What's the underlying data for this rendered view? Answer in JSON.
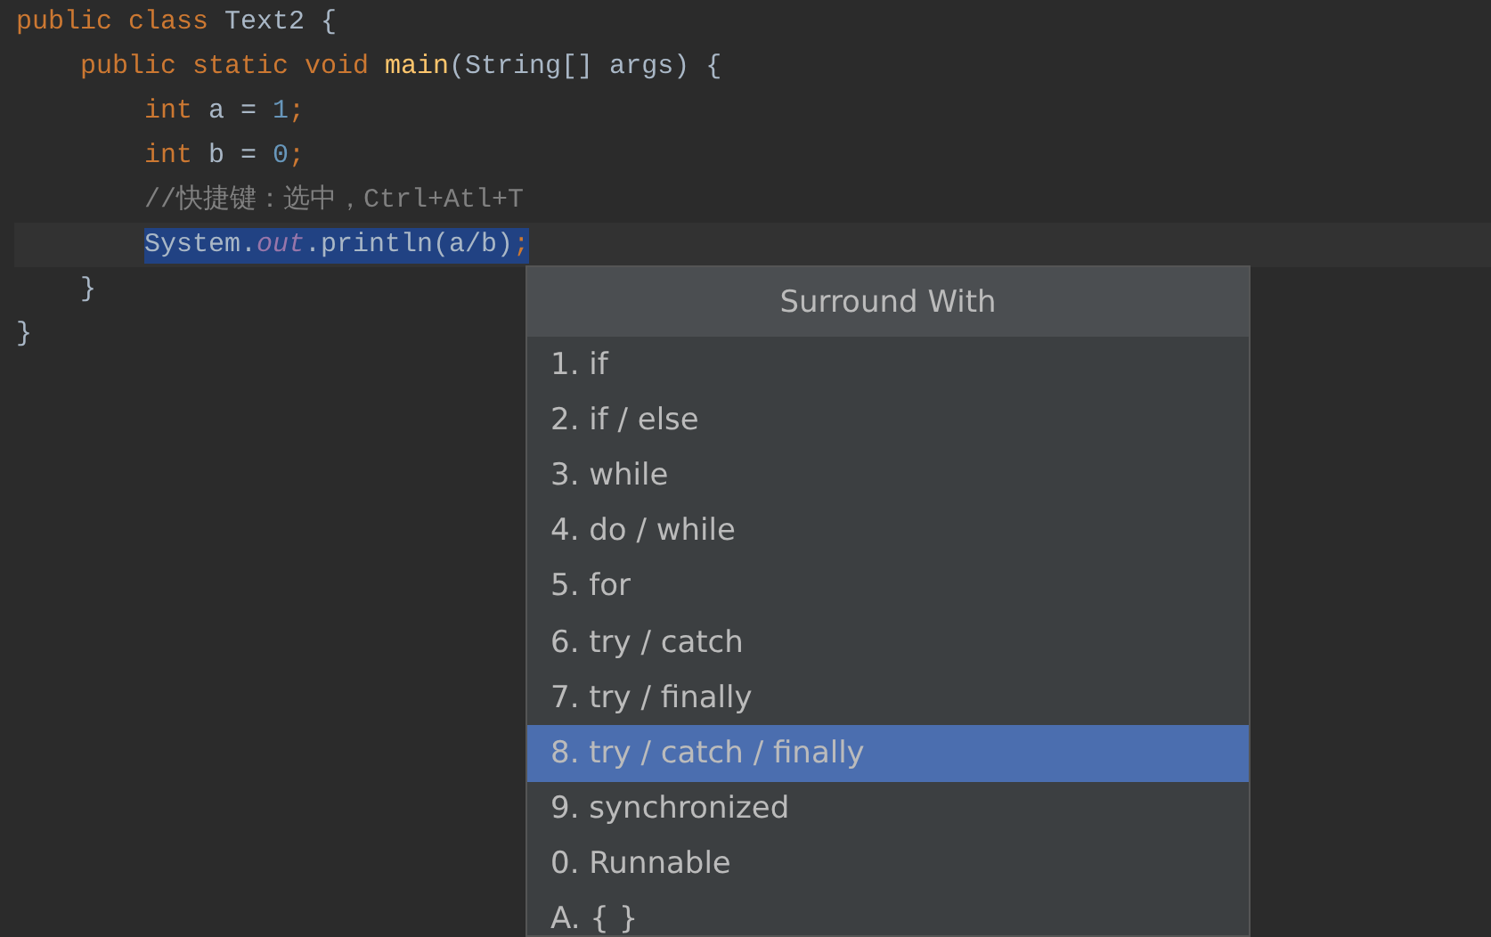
{
  "editor": {
    "lines": [
      {
        "selected": false,
        "tokens": [
          {
            "kind": "keyword",
            "text": "public class "
          },
          {
            "kind": "plain",
            "text": "Text2 {"
          }
        ],
        "children": [
          {
            "selected": false,
            "tokens": [
              {
                "kind": "keyword",
                "text": "public static void "
              },
              {
                "kind": "method",
                "text": "main"
              },
              {
                "kind": "plain",
                "text": "(String[] args) {"
              }
            ],
            "children": [
              {
                "selected": false,
                "tokens": [
                  {
                    "kind": "keyword",
                    "text": "int "
                  },
                  {
                    "kind": "plain",
                    "text": "a = "
                  },
                  {
                    "kind": "number",
                    "text": "1"
                  },
                  {
                    "kind": "keyword",
                    "text": ";"
                  }
                ]
              },
              {
                "selected": false,
                "tokens": [
                  {
                    "kind": "keyword",
                    "text": "int "
                  },
                  {
                    "kind": "plain",
                    "text": "b = "
                  },
                  {
                    "kind": "number",
                    "text": "0"
                  },
                  {
                    "kind": "keyword",
                    "text": ";"
                  }
                ]
              },
              {
                "selected": false,
                "tokens": [
                  {
                    "kind": "comment",
                    "text": "//快捷键：选中，Ctrl+Atl+T"
                  }
                ]
              },
              {
                "selected": true,
                "tokens": [
                  {
                    "kind": "plain",
                    "text": "System."
                  },
                  {
                    "kind": "field",
                    "text": "out"
                  },
                  {
                    "kind": "plain",
                    "text": ".println(a/b)"
                  },
                  {
                    "kind": "keyword",
                    "text": ";"
                  }
                ]
              }
            ]
          },
          {
            "selected": false,
            "tokens": [
              {
                "kind": "plain",
                "text": "}"
              }
            ]
          }
        ]
      },
      {
        "selected": false,
        "tokens": [
          {
            "kind": "plain",
            "text": "}"
          }
        ]
      }
    ]
  },
  "popup": {
    "title": "Surround With",
    "items": [
      {
        "label": "1. if",
        "selected": false
      },
      {
        "label": "2. if / else",
        "selected": false
      },
      {
        "label": "3. while",
        "selected": false
      },
      {
        "label": "4. do / while",
        "selected": false
      },
      {
        "label": "5. for",
        "selected": false
      },
      {
        "label": "6. try / catch",
        "selected": false
      },
      {
        "label": "7. try / finally",
        "selected": false
      },
      {
        "label": "8. try / catch / finally",
        "selected": true
      },
      {
        "label": "9. synchronized",
        "selected": false
      },
      {
        "label": "0. Runnable",
        "selected": false
      },
      {
        "label": "A. { }",
        "selected": false
      }
    ]
  }
}
